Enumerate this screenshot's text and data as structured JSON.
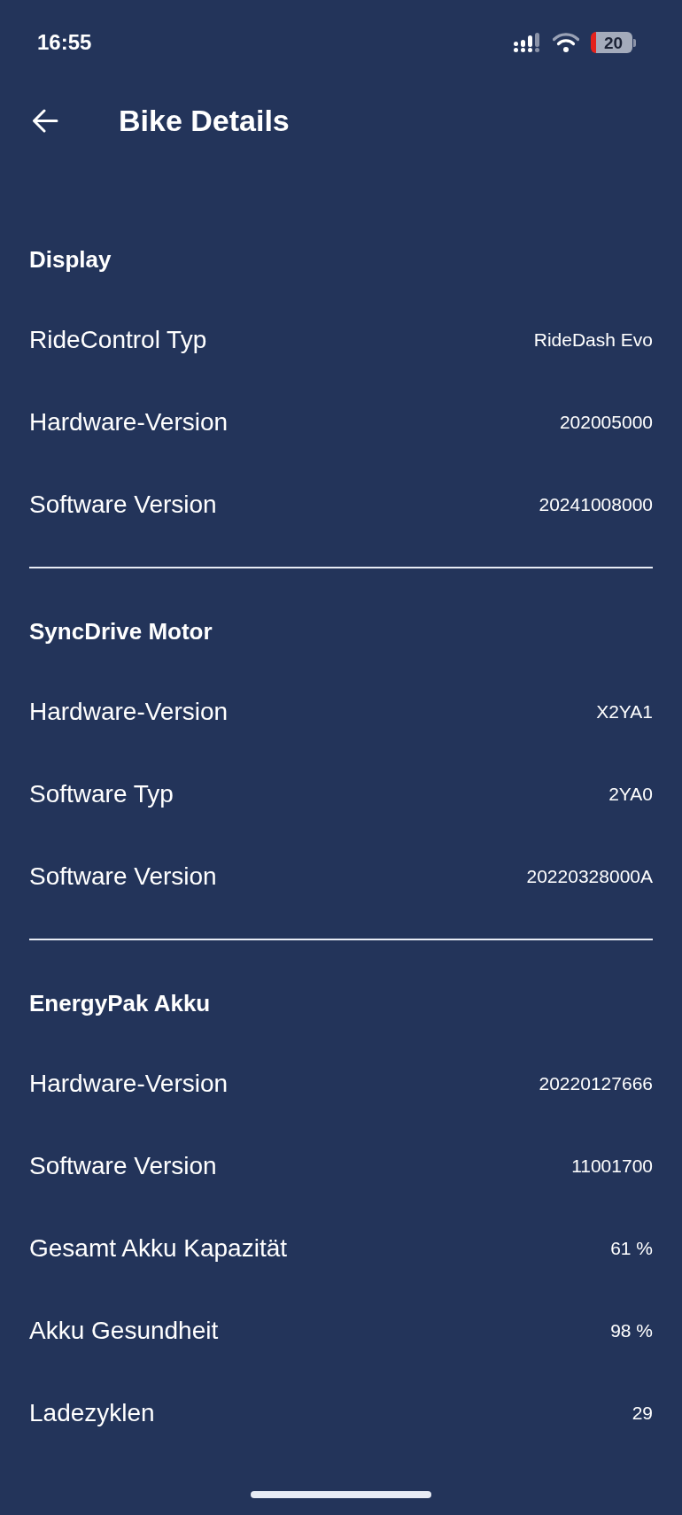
{
  "status_bar": {
    "time": "16:55",
    "battery": "20"
  },
  "header": {
    "title": "Bike Details"
  },
  "sections": [
    {
      "title": "Display",
      "rows": [
        {
          "label": "RideControl Typ",
          "value": "RideDash Evo"
        },
        {
          "label": "Hardware-Version",
          "value": "202005000"
        },
        {
          "label": "Software Version",
          "value": "20241008000"
        }
      ]
    },
    {
      "title": "SyncDrive Motor",
      "rows": [
        {
          "label": "Hardware-Version",
          "value": "X2YA1"
        },
        {
          "label": "Software Typ",
          "value": "2YA0"
        },
        {
          "label": "Software Version",
          "value": "20220328000A"
        }
      ]
    },
    {
      "title": "EnergyPak Akku",
      "rows": [
        {
          "label": "Hardware-Version",
          "value": "20220127666"
        },
        {
          "label": "Software Version",
          "value": "11001700"
        },
        {
          "label": "Gesamt Akku Kapazität",
          "value": "61 %"
        },
        {
          "label": "Akku Gesundheit",
          "value": "98 %"
        },
        {
          "label": "Ladezyklen",
          "value": "29"
        }
      ]
    }
  ]
}
